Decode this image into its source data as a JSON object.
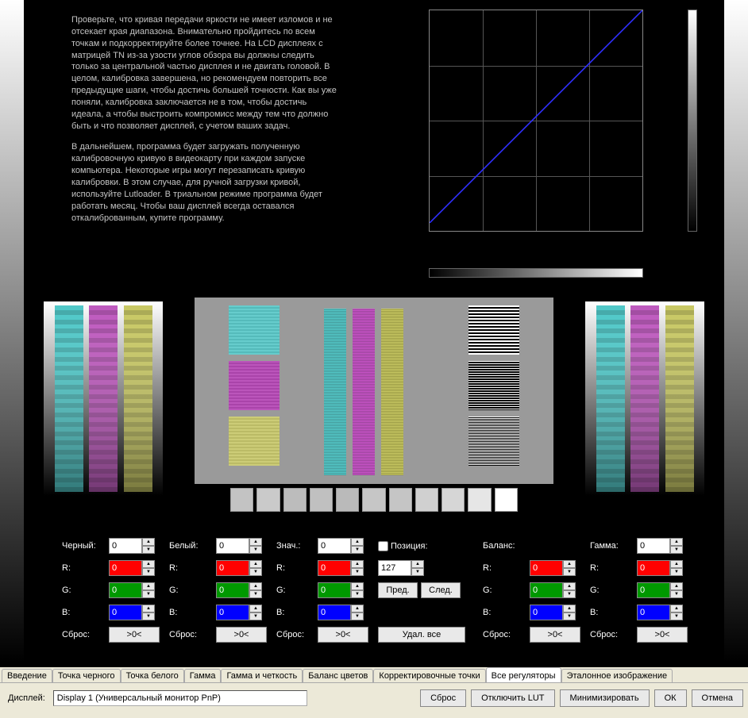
{
  "text": {
    "p1": "Проверьте, что кривая передачи яркости не имеет изломов и не отсекает края диапазона. Внимательно пройдитесь по всем точкам и подкорректируйте более точнее. На LCD дисплеях с матрицей TN из-за узости углов обзора вы должны следить только за центральной частью дисплея и не двигать головой. В целом, калибровка завершена, но рекомендуем повторить все предыдущие шаги, чтобы достичь большей точности. Как вы уже поняли, калибровка заключается не в том, чтобы достичь идеала, а чтобы выстроить компромисс между тем что должно быть и что позволяет дисплей, с учетом ваших задач.",
    "p2": "В дальнейшем, программа будет загружать полученную калибровочную кривую в видеокарту при каждом запуске компьютера. Некоторые игры могут перезаписать кривую калибровки. В этом случае, для ручной загрузки кривой, используйте Lutloader. В триальном режиме программа будет работать месяц. Чтобы ваш дисплей всегда оставался откалиброванным, купите программу."
  },
  "labels": {
    "black": "Черный:",
    "white": "Белый:",
    "value": "Знач.:",
    "position": "Позиция:",
    "balance": "Баланс:",
    "gamma": "Гамма:",
    "r": "R:",
    "g": "G:",
    "b": "B:",
    "reset": "Сброс:",
    "reset_btn": ">0<",
    "prev": "Пред.",
    "next": "След.",
    "del_all": "Удал. все"
  },
  "values": {
    "black": "0",
    "black_r": "0",
    "black_g": "0",
    "black_b": "0",
    "white": "0",
    "white_r": "0",
    "white_g": "0",
    "white_b": "0",
    "val": "0",
    "val_r": "0",
    "val_g": "0",
    "val_b": "0",
    "pos": "127",
    "balance": "",
    "bal_r": "0",
    "bal_g": "0",
    "bal_b": "0",
    "gamma": "0",
    "gam_r": "0",
    "gam_g": "0",
    "gam_b": "0"
  },
  "greyscale": [
    "#c3c3c3",
    "#cacaca",
    "#bcbcbc",
    "#c0c0c0",
    "#bababa",
    "#c6c6c6",
    "#c5c5c5",
    "#d0d0d0",
    "#d6d6d6",
    "#e6e6e6",
    "#ffffff"
  ],
  "tabs": {
    "items": [
      "Введение",
      "Точка черного",
      "Точка белого",
      "Гамма",
      "Гамма и четкость",
      "Баланс цветов",
      "Корректировочные точки",
      "Все регуляторы",
      "Эталонное изображение"
    ],
    "active": 7
  },
  "bottom": {
    "display_label": "Дисплей:",
    "display_value": "Display 1 (Универсальный монитор PnP)",
    "reset": "Сброс",
    "disable_lut": "Отключить LUT",
    "minimize": "Минимизировать",
    "ok": "ОК",
    "cancel": "Отмена"
  },
  "chart_data": {
    "type": "line",
    "title": "",
    "xlabel": "",
    "ylabel": "",
    "xlim": [
      0,
      255
    ],
    "ylim": [
      0,
      255
    ],
    "series": [
      {
        "name": "curve",
        "x": [
          0,
          255
        ],
        "y": [
          0,
          255
        ]
      }
    ]
  }
}
